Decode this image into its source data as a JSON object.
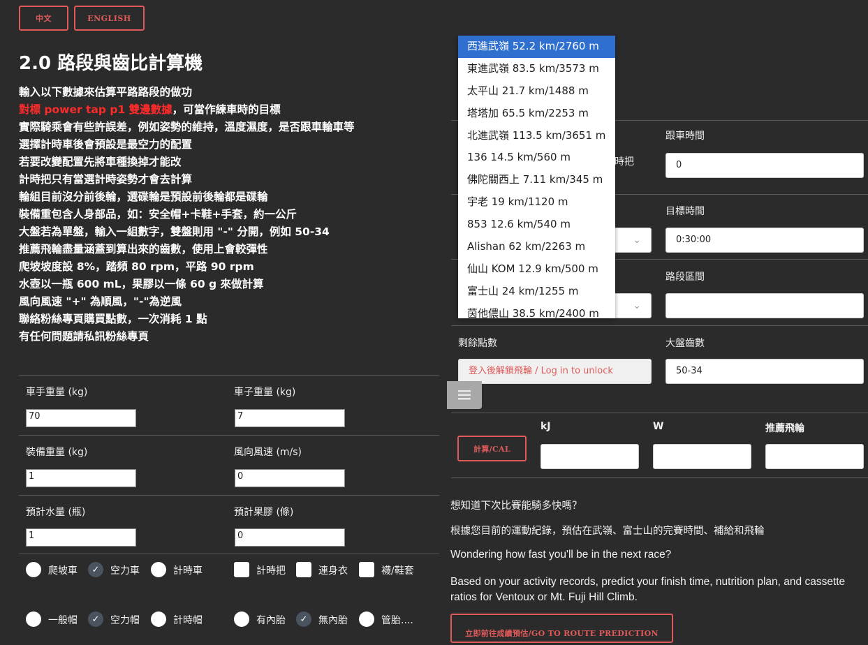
{
  "lang": {
    "zh": "中文",
    "en": "ENGLISH"
  },
  "title": "2.0 路段與齒比計算機",
  "notes": {
    "l1": "輸入以下數據來估算平路路段的做功",
    "l2_red": "對標 power tap p1 雙邊數據",
    "l2_rest": "，可當作練車時的目標",
    "l3": "實際騎乘會有些許誤差，例如姿勢的維持，溫度濕度，是否跟車輪車等",
    "l4": "選擇計時車後會預設是最空力的配置",
    "l5": "若要改變配置先將車種換掉才能改",
    "l6": "計時把只有當選計時姿勢才會去計算",
    "l7": "輪組目前沒分前後輪，選碟輪是預設前後輪都是碟輪",
    "l8": "裝備重包含人身部品，如：安全帽+卡鞋+手套，約一公斤",
    "l9": "大盤若為單盤，輸入一組數字，雙盤則用 \"-\" 分開，例如 50-34",
    "l10": "推薦飛輪盡量涵蓋到算出來的齒數，使用上會較彈性",
    "l11": "爬坡坡度設 8%，踏頻 80 rpm，平路 90 rpm",
    "l12": "水壺以一瓶 600 mL，果膠以一條 60 g 來做計算",
    "l13": "風向風速 \"+\" 為順風，\"-\"為逆風",
    "l14": "聯絡粉絲專頁購買點數，一次消耗 1 點",
    "l15": "有任何問題請私訊粉絲專頁"
  },
  "form": {
    "rider_weight_label": "車手重量 (kg)",
    "rider_weight": "70",
    "bike_weight_label": "車子重量 (kg)",
    "bike_weight": "7",
    "gear_weight_label": "裝備重量 (kg)",
    "gear_weight": "1",
    "wind_label": "風向風速 (m/s)",
    "wind": "0",
    "water_label": "預計水量 (瓶)",
    "water": "1",
    "gel_label": "預計果膠 (條)",
    "gel": "0"
  },
  "options": {
    "climb_bike": "爬坡車",
    "aero_bike": "空力車",
    "tt_bike": "計時車",
    "tt_bar": "計時把",
    "skinsuit": "連身衣",
    "socks": "襪/鞋套",
    "normal_helmet": "一般帽",
    "aero_helmet": "空力帽",
    "tt_helmet": "計時帽",
    "tube": "有內胎",
    "tubeless": "無內胎",
    "tubular": "管胎...."
  },
  "right": {
    "follow_time_label": "跟車時間",
    "follow_time": "0",
    "target_time_label": "目標時間",
    "target_time": "0:30:00",
    "segment_label": "路段區間",
    "segment": "",
    "points_label": "剩餘點數",
    "points_placeholder": "登入後解鎖飛輪 / Log in to unlock",
    "chainring_label": "大盤齒數",
    "chainring": "50-34",
    "hidden_fragment": "時把",
    "calc_button": "計算/CAL",
    "kj_label": "kJ",
    "w_label": "W",
    "cassette_label": "推薦飛輪"
  },
  "promo": {
    "q_zh": "想知道下次比賽能騎多快嗎？",
    "desc_zh": "根據您目前的運動紀錄，預估在武嶺、富士山的完賽時間、補給和飛輪",
    "q_en": "Wondering how fast you'll be in the next race?",
    "desc_en": "Based on your activity records, predict your finish time, nutrition plan, and cassette ratios for Ventoux or Mt. Fuji Hill Climb.",
    "button": "立即前往成績預估/GO TO ROUTE PREDICTION"
  },
  "dropdown": {
    "items": [
      "西進武嶺 52.2 km/2760 m",
      "東進武嶺 83.5 km/3573 m",
      "太平山 21.7 km/1488 m",
      "塔塔加 65.5 km/2253 m",
      "北進武嶺 113.5 km/3651 m",
      "136 14.5 km/560 m",
      "佛陀關西上 7.11 km/345 m",
      "宇老 19 km/1120 m",
      "853 12.6 km/540 m",
      "Alishan 62 km/2263 m",
      "仙山 KOM 12.9 km/500 m",
      "富士山 24 km/1255 m",
      "茵他儂山 38.5 km/2400 m"
    ]
  },
  "colors": {
    "accent": "#e05a5a",
    "highlight_text": "#ff2b2b",
    "selected": "#2f6fcf"
  }
}
